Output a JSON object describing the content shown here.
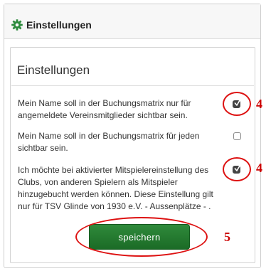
{
  "window": {
    "title": "Einstellungen",
    "icon": "gear-icon"
  },
  "panel": {
    "title": "Einstellungen",
    "options": [
      {
        "label": "Mein Name soll in der Buchungsmatrix nur für angemeldete Vereinsmitglieder sichtbar sein.",
        "checked": true,
        "annotation": "4"
      },
      {
        "label": "Mein Name soll in der Buchungsmatrix für jeden sichtbar sein.",
        "checked": false,
        "annotation": ""
      },
      {
        "label": "Ich möchte bei aktivierter Mitspielereinstellung des Clubs, von anderen Spielern als Mitspieler hinzugebucht werden können. Diese Einstellung gilt nur für TSV Glinde von 1930 e.V. - Aussenplätze - .",
        "checked": true,
        "annotation": "4"
      }
    ],
    "save_label": "speichern",
    "save_annotation": "5"
  },
  "colors": {
    "accent": "#1f7a2e",
    "annotation": "#dd1111",
    "gear": "#2e8b3e"
  }
}
